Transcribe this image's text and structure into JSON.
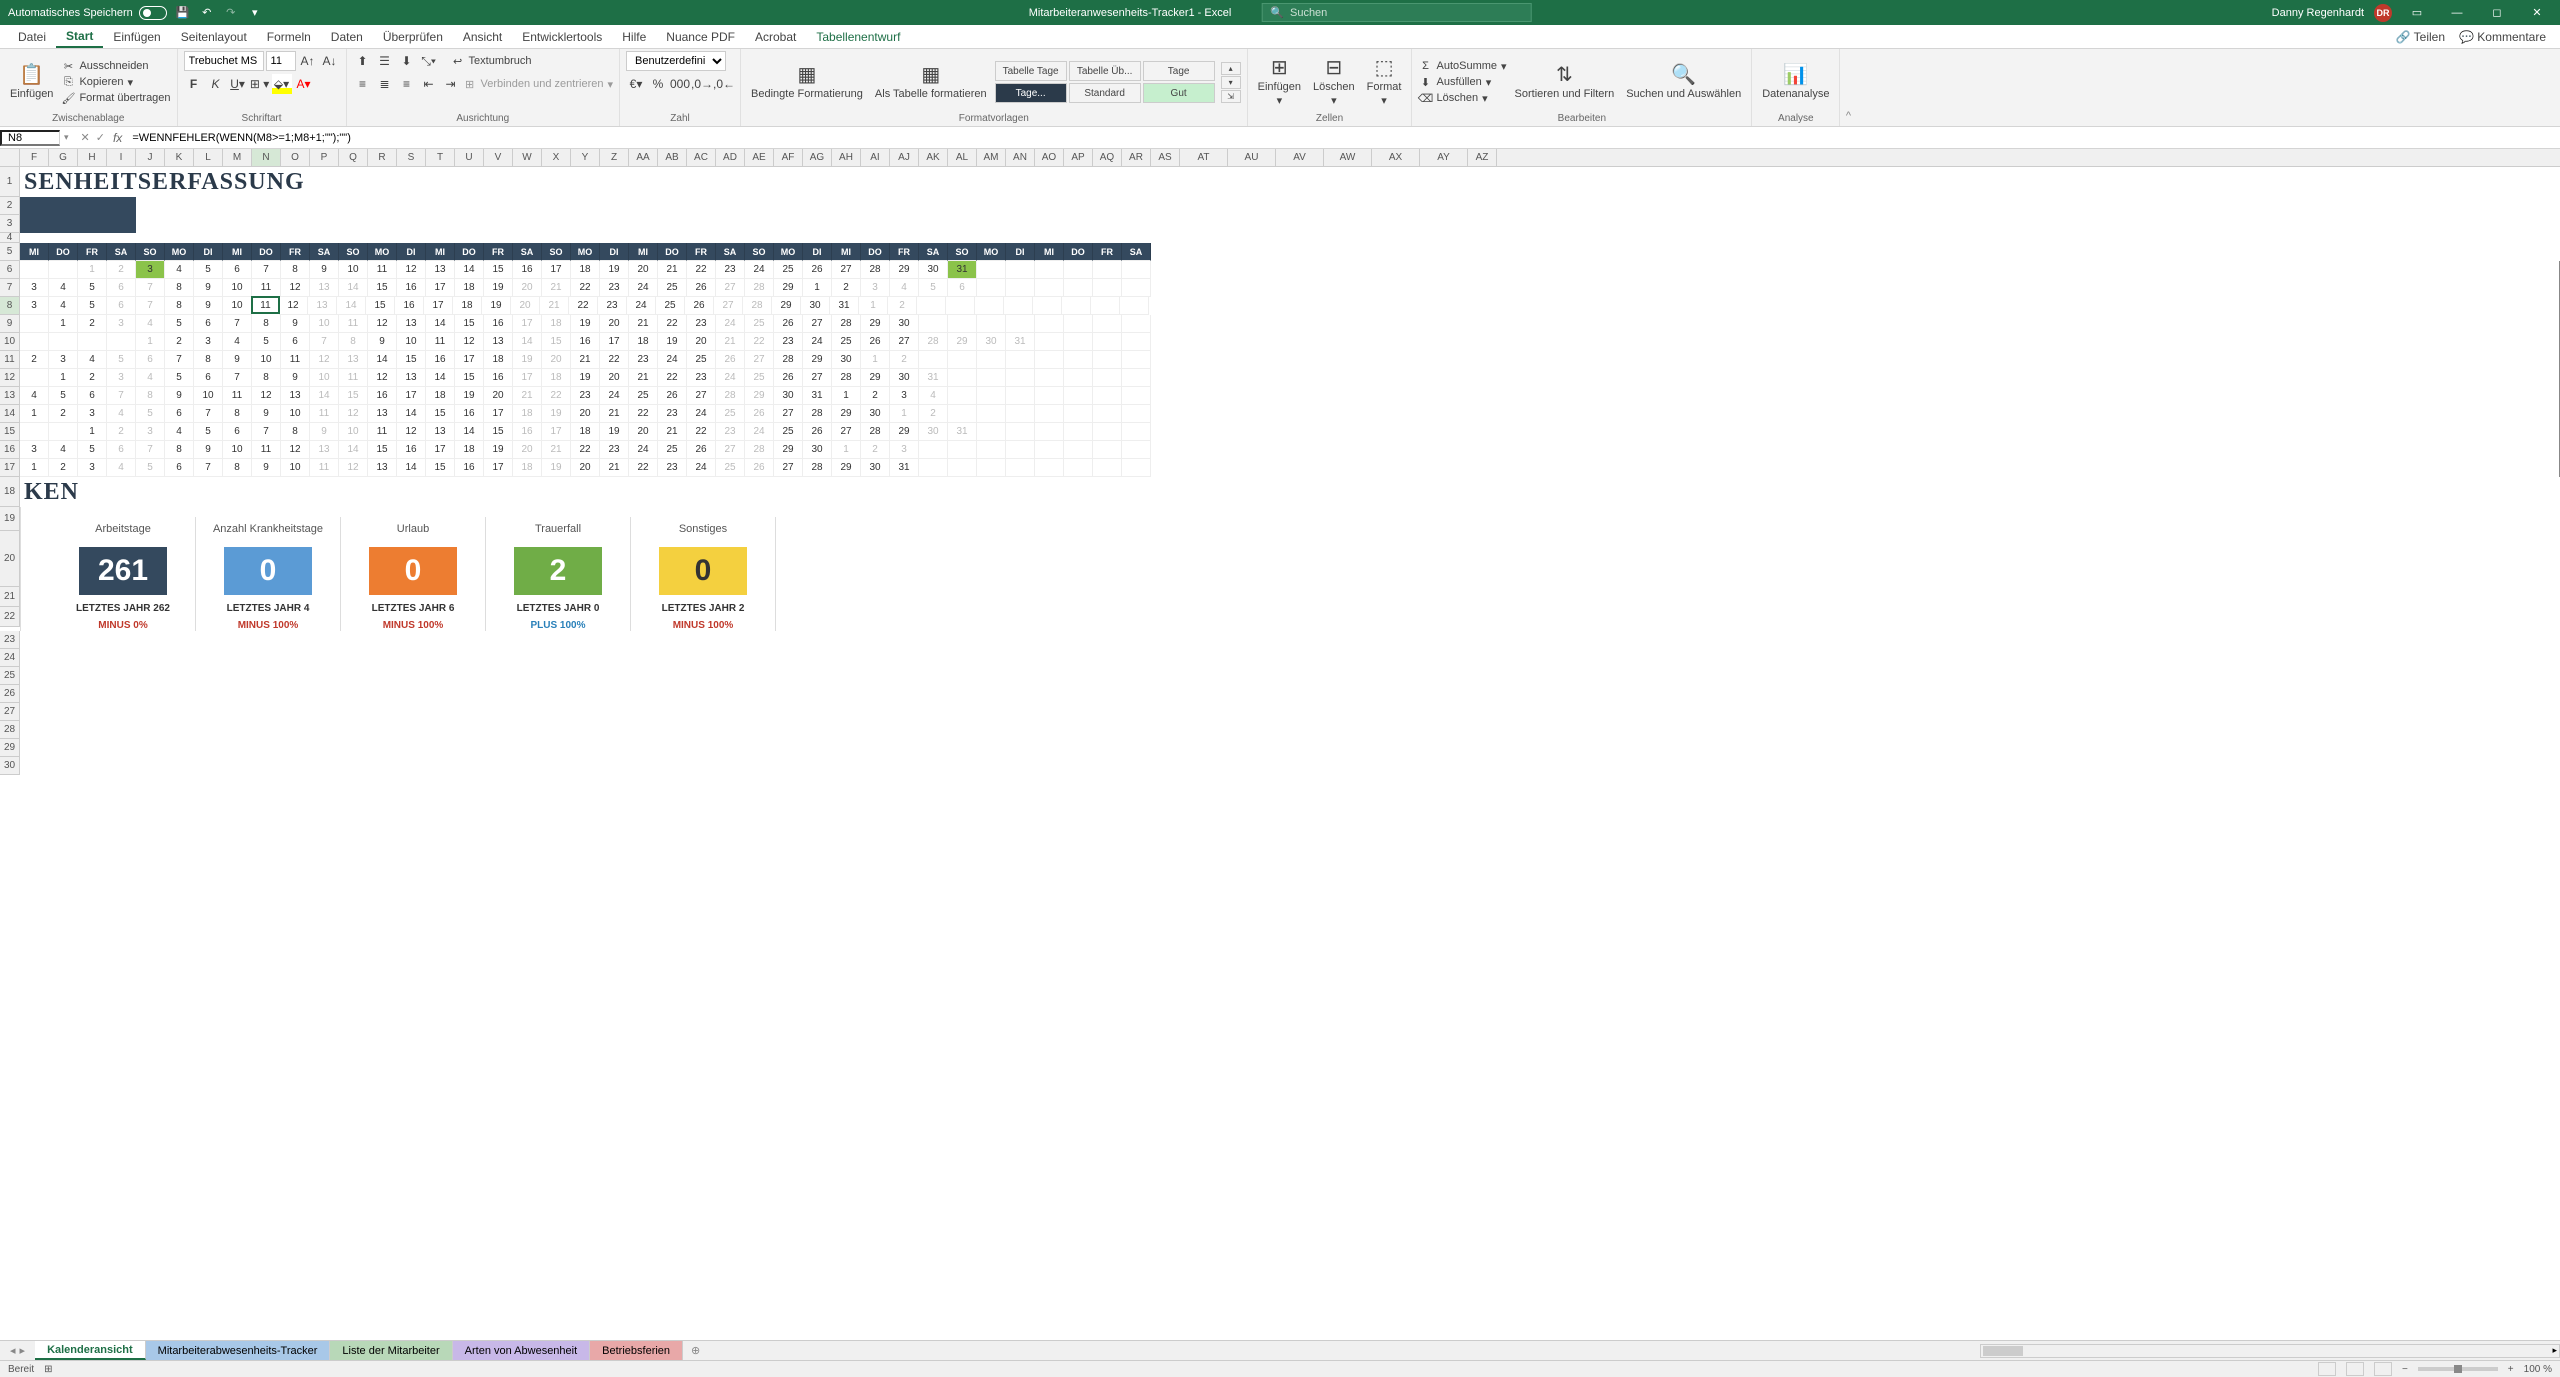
{
  "titlebar": {
    "autosave": "Automatisches Speichern",
    "filename": "Mitarbeiteranwesenheits-Tracker1 - Excel",
    "search_placeholder": "Suchen",
    "username": "Danny Regenhardt",
    "user_initials": "DR"
  },
  "tabs": {
    "datei": "Datei",
    "start": "Start",
    "einfuegen": "Einfügen",
    "seitenlayout": "Seitenlayout",
    "formeln": "Formeln",
    "daten": "Daten",
    "ueberpruefen": "Überprüfen",
    "ansicht": "Ansicht",
    "entwicklertools": "Entwicklertools",
    "hilfe": "Hilfe",
    "nuance": "Nuance PDF",
    "acrobat": "Acrobat",
    "tabellenentwurf": "Tabellenentwurf",
    "teilen": "Teilen",
    "kommentare": "Kommentare"
  },
  "ribbon": {
    "einfuegen": "Einfügen",
    "ausschneiden": "Ausschneiden",
    "kopieren": "Kopieren",
    "format_uebertragen": "Format übertragen",
    "zwischenablage": "Zwischenablage",
    "font_name": "Trebuchet MS",
    "font_size": "11",
    "schriftart": "Schriftart",
    "ausrichtung": "Ausrichtung",
    "textumbruch": "Textumbruch",
    "verbinden": "Verbinden und zentrieren",
    "zahl": "Zahl",
    "number_format": "Benutzerdefiniert",
    "bedingte": "Bedingte Formatierung",
    "als_tabelle": "Als Tabelle formatieren",
    "formatvorlagen": "Formatvorlagen",
    "style_tage1": "Tabelle Tage",
    "style_ueb": "Tabelle Üb...",
    "style_tage2": "Tage",
    "style_tage3": "Tage...",
    "style_standard": "Standard",
    "style_gut": "Gut",
    "zellen_einfuegen": "Einfügen",
    "zellen_loeschen": "Löschen",
    "zellen_format": "Format",
    "zellen": "Zellen",
    "autosumme": "AutoSumme",
    "ausfuellen": "Ausfüllen",
    "loeschen": "Löschen",
    "sortieren": "Sortieren und Filtern",
    "suchen": "Suchen und Auswählen",
    "bearbeiten": "Bearbeiten",
    "datenanalyse": "Datenanalyse",
    "analyse": "Analyse"
  },
  "formula": {
    "cell_ref": "N8",
    "formula": "=WENNFEHLER(WENN(M8>=1;M8+1;\"\");\"\")"
  },
  "columns": [
    "F",
    "G",
    "H",
    "I",
    "J",
    "K",
    "L",
    "M",
    "N",
    "O",
    "P",
    "Q",
    "R",
    "S",
    "T",
    "U",
    "V",
    "W",
    "X",
    "Y",
    "Z",
    "AA",
    "AB",
    "AC",
    "AD",
    "AE",
    "AF",
    "AG",
    "AH",
    "AI",
    "AJ",
    "AK",
    "AL",
    "AM",
    "AN",
    "AO",
    "AP",
    "AQ",
    "AR",
    "AS",
    "AT",
    "AU",
    "AV",
    "AW",
    "AX",
    "AY",
    "AZ"
  ],
  "sheet": {
    "title": "SENHEITSERFASSUNG",
    "ken": "KEN",
    "day_headers": [
      "MI",
      "DO",
      "FR",
      "SA",
      "SO",
      "MO",
      "DI",
      "MI",
      "DO",
      "FR",
      "SA",
      "SO",
      "MO",
      "DI",
      "MI",
      "DO",
      "FR",
      "SA",
      "SO",
      "MO",
      "DI",
      "MI",
      "DO",
      "FR",
      "SA",
      "SO",
      "MO",
      "DI",
      "MI",
      "DO",
      "FR",
      "SA",
      "SO",
      "MO",
      "DI",
      "MI",
      "DO",
      "FR",
      "SA"
    ],
    "rows": [
      {
        "num": 6,
        "cells": [
          "",
          "",
          "1",
          "2",
          "3",
          "4",
          "5",
          "6",
          "7",
          "8",
          "9",
          "10",
          "11",
          "12",
          "13",
          "14",
          "15",
          "16",
          "17",
          "18",
          "19",
          "20",
          "21",
          "22",
          "23",
          "24",
          "25",
          "26",
          "27",
          "28",
          "29",
          "30",
          "31",
          "",
          "",
          "",
          "",
          "",
          ""
        ],
        "faded": [
          2,
          3,
          34
        ],
        "hl": [
          4,
          32
        ]
      },
      {
        "num": 7,
        "cells": [
          "3",
          "4",
          "5",
          "6",
          "7",
          "8",
          "9",
          "10",
          "11",
          "12",
          "13",
          "14",
          "15",
          "16",
          "17",
          "18",
          "19",
          "20",
          "21",
          "22",
          "23",
          "24",
          "25",
          "26",
          "27",
          "28",
          "29",
          "1",
          "2",
          "3",
          "4",
          "5",
          "6",
          "",
          "",
          "",
          "",
          "",
          ""
        ],
        "faded": [
          3,
          4,
          10,
          11,
          17,
          18,
          24,
          25,
          29,
          30,
          31,
          32
        ]
      },
      {
        "num": 8,
        "cells": [
          "3",
          "4",
          "5",
          "6",
          "7",
          "8",
          "9",
          "10",
          "11",
          "12",
          "13",
          "14",
          "15",
          "16",
          "17",
          "18",
          "19",
          "20",
          "21",
          "22",
          "23",
          "24",
          "25",
          "26",
          "27",
          "28",
          "29",
          "30",
          "31",
          "1",
          "2",
          "",
          "",
          "",
          "",
          "",
          "",
          "",
          ""
        ],
        "faded": [
          3,
          4,
          10,
          11,
          17,
          18,
          24,
          25,
          29,
          30
        ],
        "sel": 8
      },
      {
        "num": 9,
        "cells": [
          "",
          "1",
          "2",
          "3",
          "4",
          "5",
          "6",
          "7",
          "8",
          "9",
          "10",
          "11",
          "12",
          "13",
          "14",
          "15",
          "16",
          "17",
          "18",
          "19",
          "20",
          "21",
          "22",
          "23",
          "24",
          "25",
          "26",
          "27",
          "28",
          "29",
          "30",
          "",
          "",
          "",
          "",
          "",
          "",
          "",
          ""
        ],
        "faded": [
          3,
          4,
          10,
          11,
          17,
          18,
          24,
          25
        ]
      },
      {
        "num": 10,
        "cells": [
          "",
          "",
          "",
          "",
          "1",
          "2",
          "3",
          "4",
          "5",
          "6",
          "7",
          "8",
          "9",
          "10",
          "11",
          "12",
          "13",
          "14",
          "15",
          "16",
          "17",
          "18",
          "19",
          "20",
          "21",
          "22",
          "23",
          "24",
          "25",
          "26",
          "27",
          "28",
          "29",
          "30",
          "31",
          "",
          "",
          "",
          ""
        ],
        "faded": [
          4,
          10,
          11,
          17,
          18,
          24,
          25,
          31,
          32,
          33,
          34
        ]
      },
      {
        "num": 11,
        "cells": [
          "2",
          "3",
          "4",
          "5",
          "6",
          "7",
          "8",
          "9",
          "10",
          "11",
          "12",
          "13",
          "14",
          "15",
          "16",
          "17",
          "18",
          "19",
          "20",
          "21",
          "22",
          "23",
          "24",
          "25",
          "26",
          "27",
          "28",
          "29",
          "30",
          "1",
          "2",
          "",
          "",
          "",
          "",
          "",
          "",
          "",
          ""
        ],
        "faded": [
          3,
          4,
          10,
          11,
          17,
          18,
          24,
          25,
          29,
          30
        ]
      },
      {
        "num": 12,
        "cells": [
          "",
          "1",
          "2",
          "3",
          "4",
          "5",
          "6",
          "7",
          "8",
          "9",
          "10",
          "11",
          "12",
          "13",
          "14",
          "15",
          "16",
          "17",
          "18",
          "19",
          "20",
          "21",
          "22",
          "23",
          "24",
          "25",
          "26",
          "27",
          "28",
          "29",
          "30",
          "31",
          "",
          "",
          "",
          "",
          "",
          "",
          ""
        ],
        "faded": [
          3,
          4,
          10,
          11,
          17,
          18,
          24,
          25,
          31
        ]
      },
      {
        "num": 13,
        "cells": [
          "4",
          "5",
          "6",
          "7",
          "8",
          "9",
          "10",
          "11",
          "12",
          "13",
          "14",
          "15",
          "16",
          "17",
          "18",
          "19",
          "20",
          "21",
          "22",
          "23",
          "24",
          "25",
          "26",
          "27",
          "28",
          "29",
          "30",
          "31",
          "1",
          "2",
          "3",
          "4",
          "",
          "",
          "",
          "",
          "",
          "",
          ""
        ],
        "faded": [
          3,
          4,
          10,
          11,
          17,
          18,
          24,
          25,
          31
        ]
      },
      {
        "num": 14,
        "cells": [
          "1",
          "2",
          "3",
          "4",
          "5",
          "6",
          "7",
          "8",
          "9",
          "10",
          "11",
          "12",
          "13",
          "14",
          "15",
          "16",
          "17",
          "18",
          "19",
          "20",
          "21",
          "22",
          "23",
          "24",
          "25",
          "26",
          "27",
          "28",
          "29",
          "30",
          "1",
          "2",
          "",
          "",
          "",
          "",
          "",
          "",
          ""
        ],
        "faded": [
          3,
          4,
          10,
          11,
          17,
          18,
          24,
          25,
          30,
          31
        ]
      },
      {
        "num": 15,
        "cells": [
          "",
          "",
          "1",
          "2",
          "3",
          "4",
          "5",
          "6",
          "7",
          "8",
          "9",
          "10",
          "11",
          "12",
          "13",
          "14",
          "15",
          "16",
          "17",
          "18",
          "19",
          "20",
          "21",
          "22",
          "23",
          "24",
          "25",
          "26",
          "27",
          "28",
          "29",
          "30",
          "31",
          "",
          "",
          "",
          "",
          "",
          ""
        ],
        "faded": [
          3,
          4,
          10,
          11,
          17,
          18,
          24,
          25,
          31,
          32
        ]
      },
      {
        "num": 16,
        "cells": [
          "3",
          "4",
          "5",
          "6",
          "7",
          "8",
          "9",
          "10",
          "11",
          "12",
          "13",
          "14",
          "15",
          "16",
          "17",
          "18",
          "19",
          "20",
          "21",
          "22",
          "23",
          "24",
          "25",
          "26",
          "27",
          "28",
          "29",
          "30",
          "1",
          "2",
          "3",
          "",
          "",
          "",
          "",
          "",
          "",
          "",
          ""
        ],
        "faded": [
          3,
          4,
          10,
          11,
          17,
          18,
          24,
          25,
          28,
          29,
          30
        ]
      },
      {
        "num": 17,
        "cells": [
          "1",
          "2",
          "3",
          "4",
          "5",
          "6",
          "7",
          "8",
          "9",
          "10",
          "11",
          "12",
          "13",
          "14",
          "15",
          "16",
          "17",
          "18",
          "19",
          "20",
          "21",
          "22",
          "23",
          "24",
          "25",
          "26",
          "27",
          "28",
          "29",
          "30",
          "31",
          "",
          "",
          "",
          "",
          "",
          "",
          "",
          ""
        ],
        "faded": [
          3,
          4,
          10,
          11,
          17,
          18,
          24,
          25
        ]
      }
    ]
  },
  "stats": [
    {
      "label": "Arbeitstage",
      "value": "261",
      "last": "LETZTES JAHR  262",
      "change": "MINUS 0%",
      "color": "navy",
      "changeClass": "sc-red"
    },
    {
      "label": "Anzahl Krankheitstage",
      "value": "0",
      "last": "LETZTES JAHR  4",
      "change": "MINUS 100%",
      "color": "blue",
      "changeClass": "sc-red"
    },
    {
      "label": "Urlaub",
      "value": "0",
      "last": "LETZTES JAHR  6",
      "change": "MINUS 100%",
      "color": "orange",
      "changeClass": "sc-red"
    },
    {
      "label": "Trauerfall",
      "value": "2",
      "last": "LETZTES JAHR  0",
      "change": "PLUS 100%",
      "color": "green",
      "changeClass": "sc-blue"
    },
    {
      "label": "Sonstiges",
      "value": "0",
      "last": "LETZTES JAHR  2",
      "change": "MINUS 100%",
      "color": "yellow",
      "changeClass": "sc-red"
    }
  ],
  "sheet_tabs": {
    "kalender": "Kalenderansicht",
    "tracker": "Mitarbeiterabwesenheits-Tracker",
    "liste": "Liste der Mitarbeiter",
    "arten": "Arten von Abwesenheit",
    "ferien": "Betriebsferien"
  },
  "status": {
    "bereit": "Bereit",
    "zoom": "100 %"
  }
}
